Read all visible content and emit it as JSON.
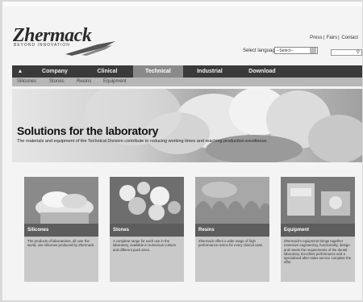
{
  "brand": {
    "name": "Zhermack",
    "tagline": "BEYOND INNOVATION"
  },
  "top_links": [
    "Press",
    "Fairs",
    "Contact"
  ],
  "language": {
    "label": "Select language",
    "selected": "--Select--"
  },
  "nav": {
    "items": [
      {
        "label": "",
        "icon": "home-icon"
      },
      {
        "label": "Company"
      },
      {
        "label": "Clinical"
      },
      {
        "label": "Technical",
        "active": true
      },
      {
        "label": "Industrial"
      },
      {
        "label": "Download"
      }
    ]
  },
  "subnav": {
    "items": [
      "Silicones",
      "Stones",
      "Resins",
      "Equipment"
    ]
  },
  "hero": {
    "title": "Solutions for the laboratory",
    "text": "The materials and equipment of the Technical Division contribute to reducing working times and reaching production excellence."
  },
  "cards": [
    {
      "title": "Silicones",
      "text": "The products of laboratories, all over the world, use silicones produced by Zhermack."
    },
    {
      "title": "Stones",
      "text": "A complete range for each use in the laboratory, available in numerous colours and different pack sizes."
    },
    {
      "title": "Resins",
      "text": "Zhermack offers a wide range of high performance resins for every clinical case."
    },
    {
      "title": "Equipment",
      "text": "Zhermack's equipment brings together extensive engineering, functionality, design and meets the requirements of the dental laboratory. Excellent performance and a specialised after-sales service complete the offer."
    }
  ],
  "colors": {
    "nav_bg": "#3a3a3a",
    "nav_active": "#8a8a8a",
    "subnav_bg": "#b7b7b7",
    "card_label_bg": "#5d5d5d"
  }
}
